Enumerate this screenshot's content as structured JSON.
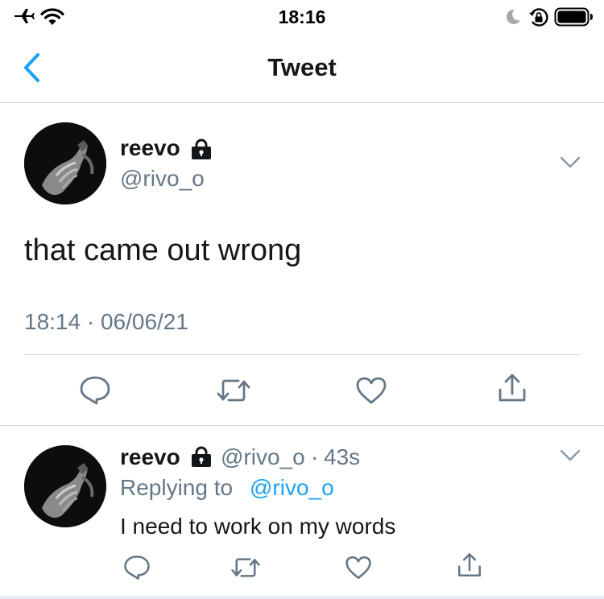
{
  "status_bar": {
    "time": "18:16",
    "icons": [
      "airplane-icon",
      "wifi-icon",
      "moon-icon",
      "orientation-lock-icon",
      "battery-icon"
    ]
  },
  "nav": {
    "title": "Tweet",
    "back_icon": "chevron-left-icon"
  },
  "tweet": {
    "display_name": "reevo",
    "handle": "@rivo_o",
    "protected_icon": "lock-icon",
    "text": "that came out wrong",
    "timestamp": "18:14 · 06/06/21",
    "actions": [
      "reply-icon",
      "retweet-icon",
      "like-icon",
      "share-icon"
    ]
  },
  "reply": {
    "display_name": "reevo",
    "handle": "@rivo_o",
    "dot": "·",
    "time_ago": "43s",
    "replying_prefix": "Replying to",
    "replying_to": "@rivo_o",
    "text": "I need to work on my words",
    "actions": [
      "reply-icon",
      "retweet-icon",
      "like-icon",
      "share-icon"
    ]
  },
  "colors": {
    "accent": "#1da1f2",
    "text": "#14171a",
    "secondary": "#657786",
    "divider": "#d5d8dc"
  }
}
